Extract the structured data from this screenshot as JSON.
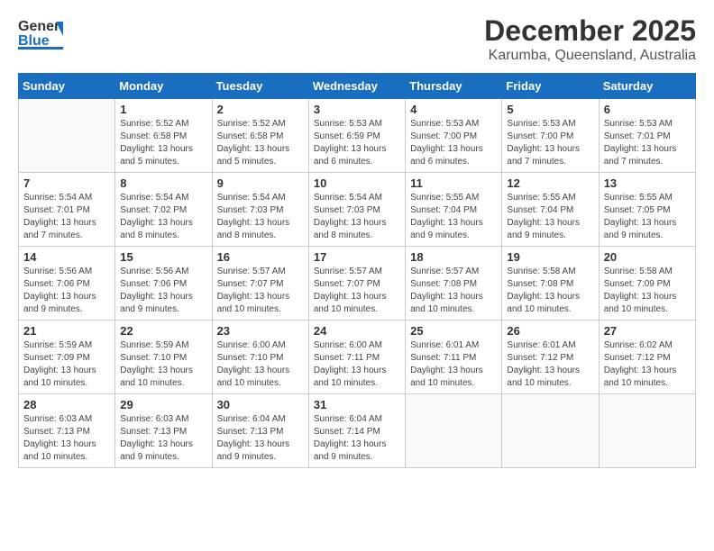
{
  "logo": {
    "line1": "General",
    "line2": "Blue"
  },
  "title": "December 2025",
  "location": "Karumba, Queensland, Australia",
  "days_of_week": [
    "Sunday",
    "Monday",
    "Tuesday",
    "Wednesday",
    "Thursday",
    "Friday",
    "Saturday"
  ],
  "weeks": [
    [
      {
        "day": "",
        "info": ""
      },
      {
        "day": "1",
        "info": "Sunrise: 5:52 AM\nSunset: 6:58 PM\nDaylight: 13 hours\nand 5 minutes."
      },
      {
        "day": "2",
        "info": "Sunrise: 5:52 AM\nSunset: 6:58 PM\nDaylight: 13 hours\nand 5 minutes."
      },
      {
        "day": "3",
        "info": "Sunrise: 5:53 AM\nSunset: 6:59 PM\nDaylight: 13 hours\nand 6 minutes."
      },
      {
        "day": "4",
        "info": "Sunrise: 5:53 AM\nSunset: 7:00 PM\nDaylight: 13 hours\nand 6 minutes."
      },
      {
        "day": "5",
        "info": "Sunrise: 5:53 AM\nSunset: 7:00 PM\nDaylight: 13 hours\nand 7 minutes."
      },
      {
        "day": "6",
        "info": "Sunrise: 5:53 AM\nSunset: 7:01 PM\nDaylight: 13 hours\nand 7 minutes."
      }
    ],
    [
      {
        "day": "7",
        "info": "Sunrise: 5:54 AM\nSunset: 7:01 PM\nDaylight: 13 hours\nand 7 minutes."
      },
      {
        "day": "8",
        "info": "Sunrise: 5:54 AM\nSunset: 7:02 PM\nDaylight: 13 hours\nand 8 minutes."
      },
      {
        "day": "9",
        "info": "Sunrise: 5:54 AM\nSunset: 7:03 PM\nDaylight: 13 hours\nand 8 minutes."
      },
      {
        "day": "10",
        "info": "Sunrise: 5:54 AM\nSunset: 7:03 PM\nDaylight: 13 hours\nand 8 minutes."
      },
      {
        "day": "11",
        "info": "Sunrise: 5:55 AM\nSunset: 7:04 PM\nDaylight: 13 hours\nand 9 minutes."
      },
      {
        "day": "12",
        "info": "Sunrise: 5:55 AM\nSunset: 7:04 PM\nDaylight: 13 hours\nand 9 minutes."
      },
      {
        "day": "13",
        "info": "Sunrise: 5:55 AM\nSunset: 7:05 PM\nDaylight: 13 hours\nand 9 minutes."
      }
    ],
    [
      {
        "day": "14",
        "info": "Sunrise: 5:56 AM\nSunset: 7:06 PM\nDaylight: 13 hours\nand 9 minutes."
      },
      {
        "day": "15",
        "info": "Sunrise: 5:56 AM\nSunset: 7:06 PM\nDaylight: 13 hours\nand 9 minutes."
      },
      {
        "day": "16",
        "info": "Sunrise: 5:57 AM\nSunset: 7:07 PM\nDaylight: 13 hours\nand 10 minutes."
      },
      {
        "day": "17",
        "info": "Sunrise: 5:57 AM\nSunset: 7:07 PM\nDaylight: 13 hours\nand 10 minutes."
      },
      {
        "day": "18",
        "info": "Sunrise: 5:57 AM\nSunset: 7:08 PM\nDaylight: 13 hours\nand 10 minutes."
      },
      {
        "day": "19",
        "info": "Sunrise: 5:58 AM\nSunset: 7:08 PM\nDaylight: 13 hours\nand 10 minutes."
      },
      {
        "day": "20",
        "info": "Sunrise: 5:58 AM\nSunset: 7:09 PM\nDaylight: 13 hours\nand 10 minutes."
      }
    ],
    [
      {
        "day": "21",
        "info": "Sunrise: 5:59 AM\nSunset: 7:09 PM\nDaylight: 13 hours\nand 10 minutes."
      },
      {
        "day": "22",
        "info": "Sunrise: 5:59 AM\nSunset: 7:10 PM\nDaylight: 13 hours\nand 10 minutes."
      },
      {
        "day": "23",
        "info": "Sunrise: 6:00 AM\nSunset: 7:10 PM\nDaylight: 13 hours\nand 10 minutes."
      },
      {
        "day": "24",
        "info": "Sunrise: 6:00 AM\nSunset: 7:11 PM\nDaylight: 13 hours\nand 10 minutes."
      },
      {
        "day": "25",
        "info": "Sunrise: 6:01 AM\nSunset: 7:11 PM\nDaylight: 13 hours\nand 10 minutes."
      },
      {
        "day": "26",
        "info": "Sunrise: 6:01 AM\nSunset: 7:12 PM\nDaylight: 13 hours\nand 10 minutes."
      },
      {
        "day": "27",
        "info": "Sunrise: 6:02 AM\nSunset: 7:12 PM\nDaylight: 13 hours\nand 10 minutes."
      }
    ],
    [
      {
        "day": "28",
        "info": "Sunrise: 6:03 AM\nSunset: 7:13 PM\nDaylight: 13 hours\nand 10 minutes."
      },
      {
        "day": "29",
        "info": "Sunrise: 6:03 AM\nSunset: 7:13 PM\nDaylight: 13 hours\nand 9 minutes."
      },
      {
        "day": "30",
        "info": "Sunrise: 6:04 AM\nSunset: 7:13 PM\nDaylight: 13 hours\nand 9 minutes."
      },
      {
        "day": "31",
        "info": "Sunrise: 6:04 AM\nSunset: 7:14 PM\nDaylight: 13 hours\nand 9 minutes."
      },
      {
        "day": "",
        "info": ""
      },
      {
        "day": "",
        "info": ""
      },
      {
        "day": "",
        "info": ""
      }
    ]
  ]
}
